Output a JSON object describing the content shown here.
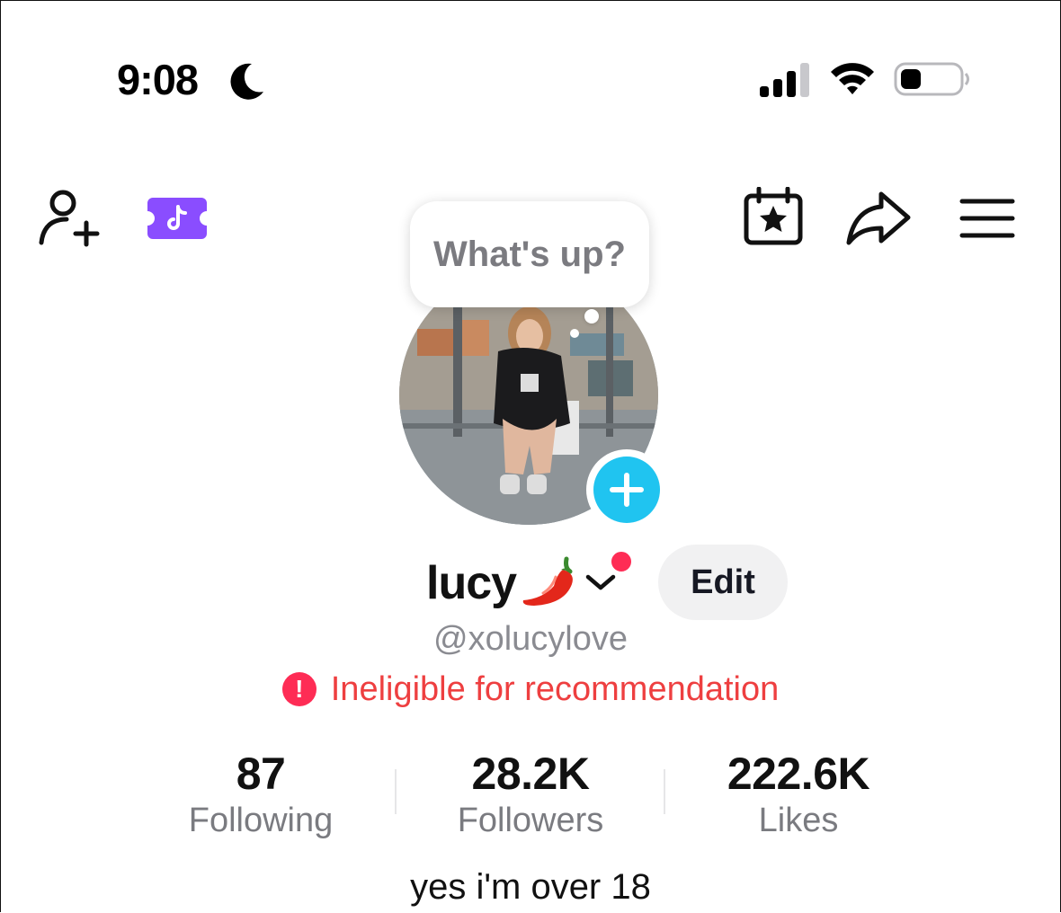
{
  "status_bar": {
    "time": "9:08",
    "icons": [
      "moon-icon",
      "signal-icon",
      "wifi-icon",
      "battery-icon"
    ]
  },
  "top_bar": {
    "icons": [
      "add-user-icon",
      "tiktok-ticket-icon",
      "calendar-star-icon",
      "share-icon",
      "menu-icon"
    ],
    "ticket_color": "#8a4dff"
  },
  "bubble": {
    "text": "What's up?"
  },
  "profile": {
    "name": "lucy",
    "name_emoji_icon": "chili-pepper-icon",
    "handle": "@xolucylove",
    "edit_label": "Edit",
    "warning": "Ineligible for recommendation",
    "warning_icon_glyph": "!",
    "bio": "yes i'm over 18"
  },
  "stats": [
    {
      "value": "87",
      "label": "Following"
    },
    {
      "value": "28.2K",
      "label": "Followers"
    },
    {
      "value": "222.6K",
      "label": "Likes"
    }
  ],
  "colors": {
    "accent_red": "#fe2c55",
    "warning_text": "#ee3f40",
    "plus_blue": "#20c4f0",
    "muted_text": "#8a8b91"
  }
}
